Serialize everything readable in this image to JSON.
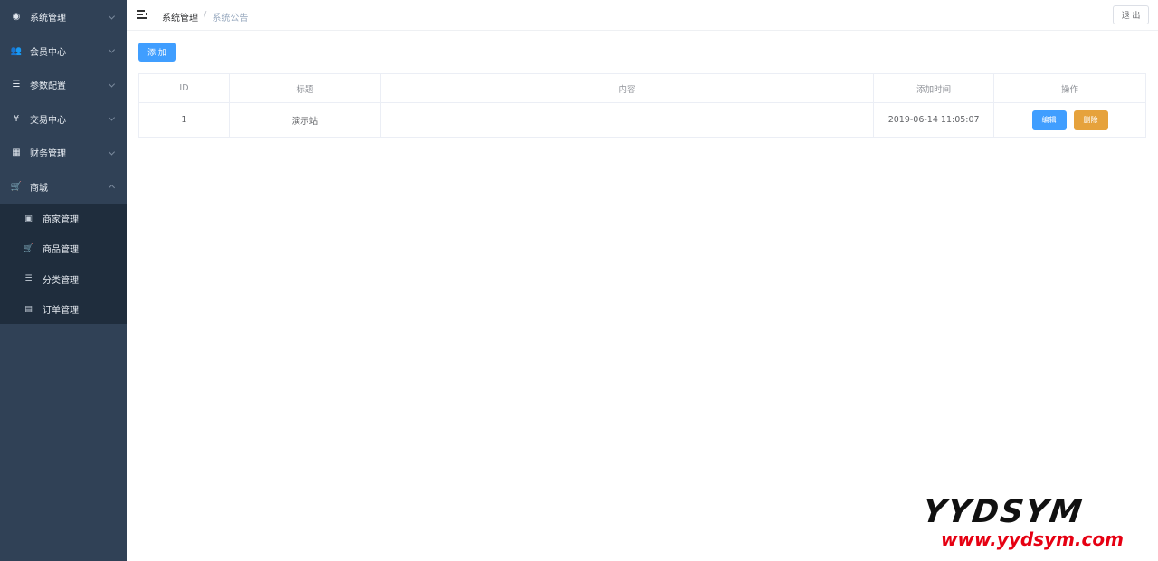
{
  "sidebar": {
    "items": [
      {
        "label": "系统管理",
        "icon": "system-icon",
        "glyph": "◉"
      },
      {
        "label": "会员中心",
        "icon": "members-icon",
        "glyph": "👥"
      },
      {
        "label": "参数配置",
        "icon": "config-list-icon",
        "glyph": "☰"
      },
      {
        "label": "交易中心",
        "icon": "yen-icon",
        "glyph": "¥"
      },
      {
        "label": "财务管理",
        "icon": "grid-icon",
        "glyph": "▦"
      },
      {
        "label": "商城",
        "icon": "cart-icon",
        "glyph": "🛒"
      }
    ],
    "submenu": [
      {
        "label": "商家管理",
        "icon": "shop-icon",
        "glyph": "▣"
      },
      {
        "label": "商品管理",
        "icon": "cart-icon",
        "glyph": "🛒"
      },
      {
        "label": "分类管理",
        "icon": "list-icon",
        "glyph": "☰"
      },
      {
        "label": "订单管理",
        "icon": "document-icon",
        "glyph": "▤"
      }
    ]
  },
  "header": {
    "breadcrumb": [
      "系统管理",
      "系统公告"
    ],
    "separator": "/",
    "logout_label": "退 出"
  },
  "toolbar": {
    "add_label": "添 加"
  },
  "table": {
    "columns": [
      "ID",
      "标题",
      "内容",
      "添加时间",
      "操作"
    ],
    "rows": [
      {
        "id": "1",
        "title": "演示站",
        "content": "",
        "time": "2019-06-14 11:05:07",
        "edit_label": "编辑",
        "delete_label": "删除"
      }
    ]
  },
  "watermark": {
    "brand": "YYDSYM",
    "url": "www.yydsym.com"
  },
  "colors": {
    "sidebar_bg": "#304156",
    "submenu_bg": "#1f2d3d",
    "primary": "#409eff",
    "warning": "#e6a23c",
    "watermark_red": "#e60012"
  }
}
